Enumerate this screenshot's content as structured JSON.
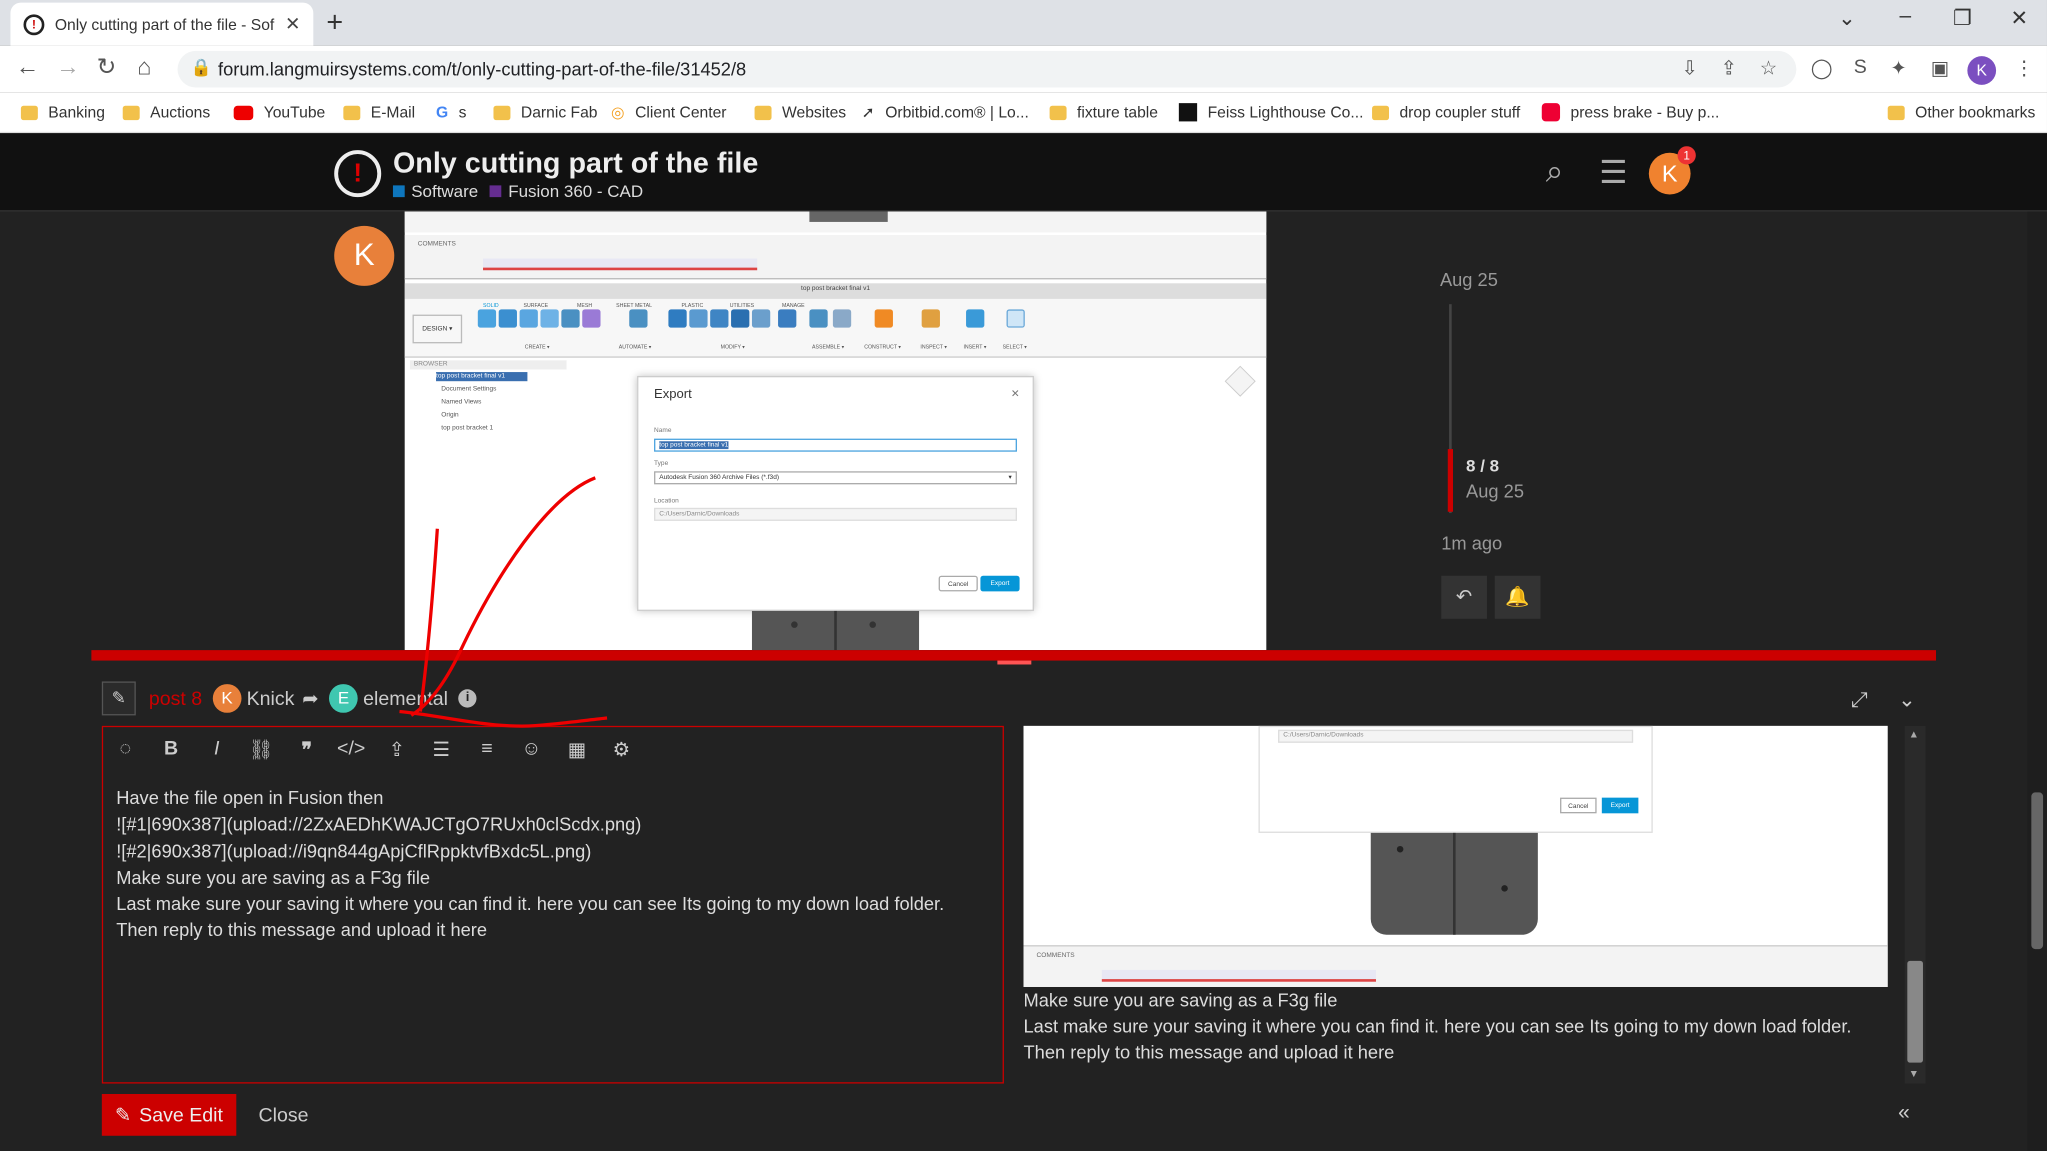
{
  "browser": {
    "tab_title": "Only cutting part of the file - Sof",
    "url": "forum.langmuirsystems.com/t/only-cutting-part-of-the-file/31452/8",
    "profile_initial": "K",
    "bookmarks": [
      "Banking",
      "Auctions",
      "YouTube",
      "E-Mail",
      "s",
      "Darnic Fab",
      "Client Center",
      "Websites",
      "Orbitbid.com® | Lo...",
      "fixture table",
      "Feiss Lighthouse Co...",
      "drop coupler stuff",
      "press brake - Buy p...",
      "Other bookmarks"
    ]
  },
  "header": {
    "title": "Only cutting part of the file",
    "category": "Software",
    "subcategory": "Fusion 360 - CAD",
    "category_color": "#0e76bd",
    "subcategory_color": "#652d90",
    "user_initial": "K",
    "notification_count": "1"
  },
  "post": {
    "avatar_initial": "K"
  },
  "embedded_screenshot": {
    "panel_label": "COMMENTS",
    "window_title": "top post bracket final v1",
    "tabs": [
      "SOLID",
      "SURFACE",
      "MESH",
      "SHEET METAL",
      "PLASTIC",
      "UTILITIES",
      "MANAGE"
    ],
    "design_label": "DESIGN ▾",
    "ribbon_groups": [
      "CREATE ▾",
      "AUTOMATE ▾",
      "MODIFY ▾",
      "ASSEMBLE ▾",
      "CONSTRUCT ▾",
      "INSPECT ▾",
      "INSERT ▾",
      "SELECT ▾"
    ],
    "browser_label": "BROWSER",
    "browser_items": [
      "top post bracket final v1",
      "Document Settings",
      "Named Views",
      "Origin",
      "top post bracket 1"
    ],
    "dialog": {
      "title": "Export",
      "name_label": "Name",
      "name_value": "top post bracket final v1",
      "type_label": "Type",
      "type_value": "Autodesk Fusion 360 Archive Files (*.f3d)",
      "location_label": "Location",
      "location_value": "C:/Users/Darnic/Downloads",
      "cancel": "Cancel",
      "export": "Export"
    }
  },
  "timeline": {
    "top_date": "Aug 25",
    "position": "8 / 8",
    "position_date": "Aug 25",
    "bottom_label": "1m ago"
  },
  "composer": {
    "action": "post 8",
    "author_initial": "K",
    "author": "Knick",
    "reply_initial": "E",
    "reply_to": "elemental",
    "editor_lines": [
      "Have the file open in Fusion then",
      "![#1|690x387](upload://2ZxAEDhKWAJCTgO7RUxh0clScdx.png)",
      "![#2|690x387](upload://i9qn844gApjCflRppktvfBxdc5L.png)",
      "Make sure you are saving as a F3g file",
      "Last make sure your saving it where you can find it. here you can see Its going to my down load folder.",
      "Then reply to this message and upload it here"
    ],
    "preview_lines": [
      "Make sure you are saving as a F3g file",
      "Last make sure your saving it where you can find it. here you can see Its going to my down load folder.",
      "Then reply to this message and upload it here"
    ],
    "preview_panel_label": "COMMENTS",
    "preview_location": "C:/Users/Darnic/Downloads",
    "save_label": "Save Edit",
    "close_label": "Close"
  },
  "colors": {
    "accent": "#cc0000",
    "avatar": "#e8803a",
    "mention_avatar": "#3fc7b0",
    "background": "#222222"
  }
}
